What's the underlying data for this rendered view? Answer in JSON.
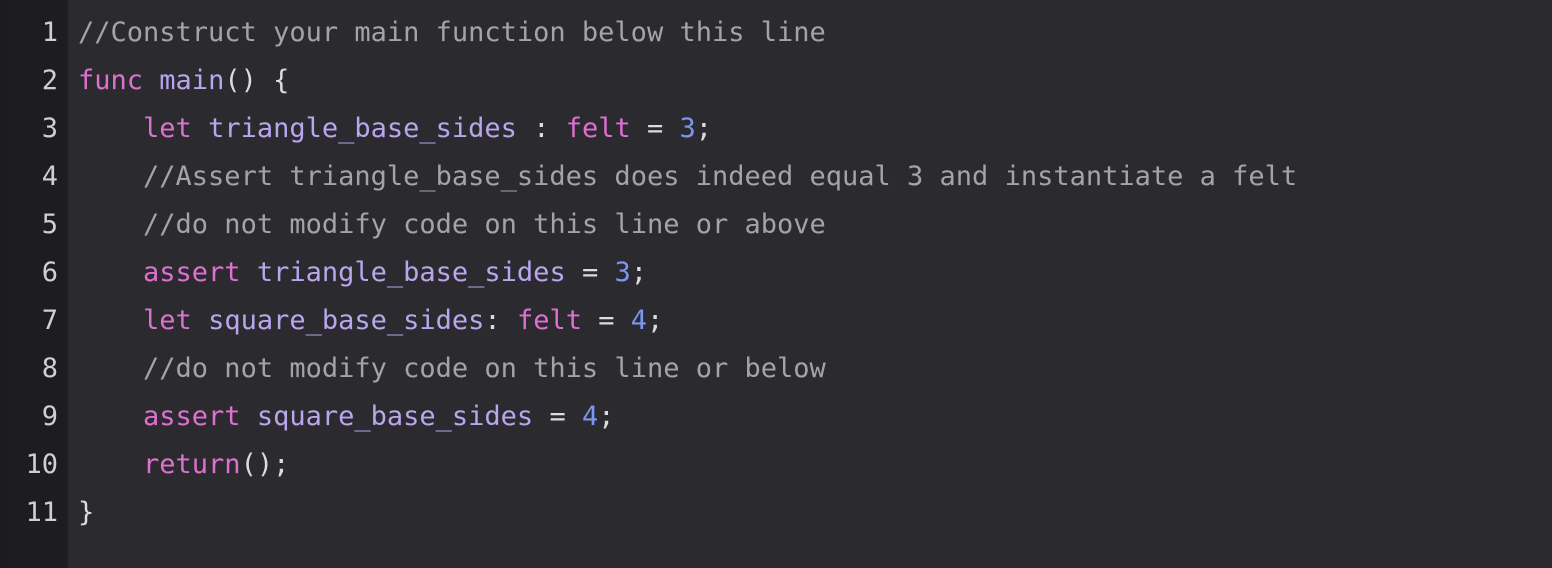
{
  "colors": {
    "background": "#2b2b2f",
    "gutter": "#1d1d20",
    "comment": "#a3a3a8",
    "keyword": "#e06fd2",
    "identifier": "#b9a6ef",
    "number": "#7d95f0",
    "text": "#dcdce0"
  },
  "lines": [
    {
      "number": "1",
      "tokens": [
        {
          "type": "comment",
          "text": "//Construct your main function below this line"
        }
      ]
    },
    {
      "number": "2",
      "tokens": [
        {
          "type": "kw",
          "text": "func"
        },
        {
          "type": "punct",
          "text": " "
        },
        {
          "type": "ident",
          "text": "main"
        },
        {
          "type": "punct",
          "text": "() {"
        }
      ]
    },
    {
      "number": "3",
      "tokens": [
        {
          "type": "punct",
          "text": "    "
        },
        {
          "type": "kw",
          "text": "let"
        },
        {
          "type": "punct",
          "text": " "
        },
        {
          "type": "ident",
          "text": "triangle_base_sides"
        },
        {
          "type": "punct",
          "text": " : "
        },
        {
          "type": "kw",
          "text": "felt"
        },
        {
          "type": "punct",
          "text": " = "
        },
        {
          "type": "num",
          "text": "3"
        },
        {
          "type": "punct",
          "text": ";"
        }
      ]
    },
    {
      "number": "4",
      "tokens": [
        {
          "type": "punct",
          "text": "    "
        },
        {
          "type": "comment",
          "text": "//Assert triangle_base_sides does indeed equal 3 and instantiate a felt"
        }
      ]
    },
    {
      "number": "5",
      "tokens": [
        {
          "type": "punct",
          "text": "    "
        },
        {
          "type": "comment",
          "text": "//do not modify code on this line or above"
        }
      ]
    },
    {
      "number": "6",
      "tokens": [
        {
          "type": "punct",
          "text": "    "
        },
        {
          "type": "kw",
          "text": "assert"
        },
        {
          "type": "punct",
          "text": " "
        },
        {
          "type": "ident",
          "text": "triangle_base_sides"
        },
        {
          "type": "punct",
          "text": " = "
        },
        {
          "type": "num",
          "text": "3"
        },
        {
          "type": "punct",
          "text": ";"
        }
      ]
    },
    {
      "number": "7",
      "tokens": [
        {
          "type": "punct",
          "text": "    "
        },
        {
          "type": "kw",
          "text": "let"
        },
        {
          "type": "punct",
          "text": " "
        },
        {
          "type": "ident",
          "text": "square_base_sides"
        },
        {
          "type": "punct",
          "text": ": "
        },
        {
          "type": "kw",
          "text": "felt"
        },
        {
          "type": "punct",
          "text": " = "
        },
        {
          "type": "num",
          "text": "4"
        },
        {
          "type": "punct",
          "text": ";"
        }
      ]
    },
    {
      "number": "8",
      "tokens": [
        {
          "type": "punct",
          "text": "    "
        },
        {
          "type": "comment",
          "text": "//do not modify code on this line or below"
        }
      ]
    },
    {
      "number": "9",
      "tokens": [
        {
          "type": "punct",
          "text": "    "
        },
        {
          "type": "kw",
          "text": "assert"
        },
        {
          "type": "punct",
          "text": " "
        },
        {
          "type": "ident",
          "text": "square_base_sides"
        },
        {
          "type": "punct",
          "text": " = "
        },
        {
          "type": "num",
          "text": "4"
        },
        {
          "type": "punct",
          "text": ";"
        }
      ]
    },
    {
      "number": "10",
      "tokens": [
        {
          "type": "punct",
          "text": "    "
        },
        {
          "type": "kw",
          "text": "return"
        },
        {
          "type": "punct",
          "text": "();"
        }
      ]
    },
    {
      "number": "11",
      "tokens": [
        {
          "type": "punct",
          "text": "}"
        }
      ]
    }
  ]
}
